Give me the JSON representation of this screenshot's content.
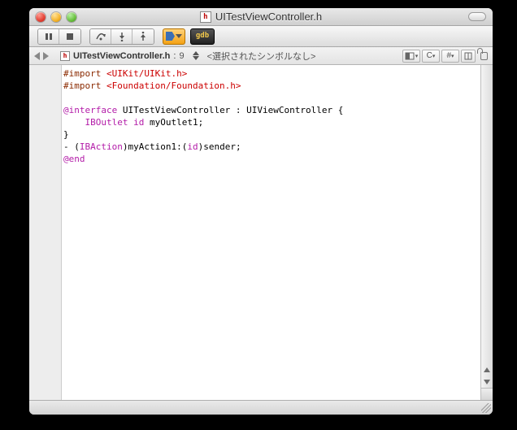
{
  "window": {
    "title": "UITestViewController.h"
  },
  "toolbar": {
    "gdb_label": "gdb"
  },
  "nav": {
    "filename": "UITestViewController.h",
    "line_sep": ":",
    "line_no": "9",
    "symbol": "<選択されたシンボルなし>",
    "btn_c": "C",
    "btn_hash": "#"
  },
  "code": {
    "l1_a": "#import ",
    "l1_b": "<UIKit/UIKit.h>",
    "l2_a": "#import ",
    "l2_b": "<Foundation/Foundation.h>",
    "blank1": "",
    "l4_a": "@interface",
    "l4_b": " UITestViewController : UIViewController {",
    "l5_pad": "    ",
    "l5_a": "IBOutlet",
    "l5_sp1": " ",
    "l5_b": "id",
    "l5_c": " myOutlet1;",
    "l6": "}",
    "l7_a": "- (",
    "l7_b": "IBAction",
    "l7_c": ")myAction1:(",
    "l7_d": "id",
    "l7_e": ")sender;",
    "l8": "@end"
  }
}
